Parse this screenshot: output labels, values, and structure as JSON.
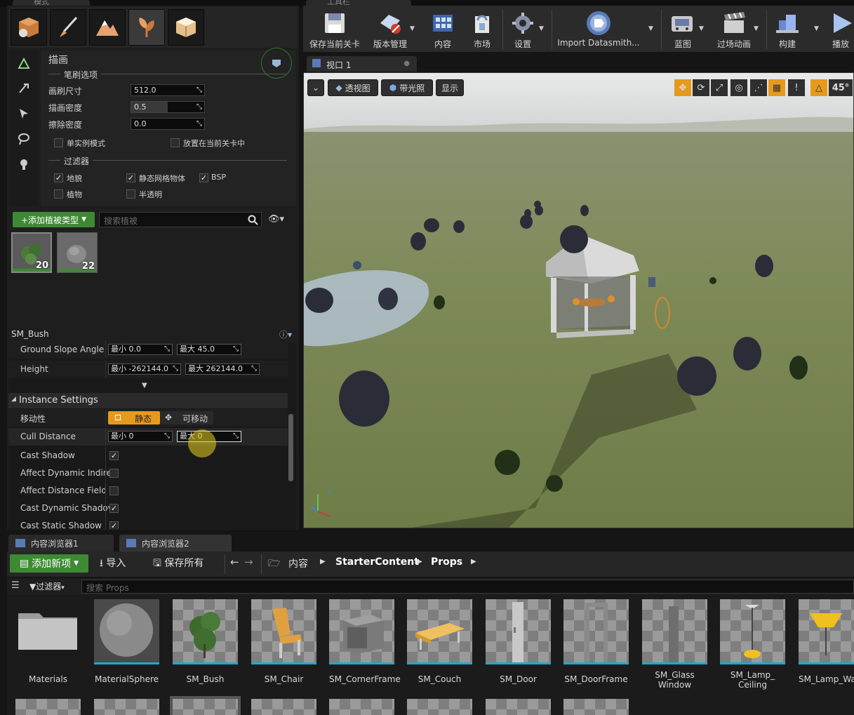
{
  "top_tabs": {
    "left": "模式",
    "right": "工具栏"
  },
  "mode_tools": [
    {
      "icon": "place-mode-icon"
    },
    {
      "icon": "paint-mode-icon"
    },
    {
      "icon": "landscape-mode-icon"
    },
    {
      "icon": "foliage-mode-icon"
    },
    {
      "icon": "geometry-mode-icon"
    }
  ],
  "foliage": {
    "panel_title": "描画",
    "brush_section": "笔刷选项",
    "brush_size_label": "画刷尺寸",
    "brush_size_value": "512.0",
    "paint_density_label": "描画密度",
    "paint_density_value": "0.5",
    "paint_density_fraction": 0.5,
    "erase_density_label": "擦除密度",
    "erase_density_value": "0.0",
    "single_instance_label": "单实例模式",
    "single_instance_checked": false,
    "place_in_level_label": "放置在当前关卡中",
    "place_in_level_checked": false,
    "filter_section": "过滤器",
    "filters": [
      {
        "label": "地貌",
        "checked": true
      },
      {
        "label": "静态网格物体",
        "checked": true
      },
      {
        "label": "BSP",
        "checked": true
      },
      {
        "label": "植物",
        "checked": false
      },
      {
        "label": "半透明",
        "checked": false
      }
    ],
    "add_button": "+添加植被类型",
    "search_placeholder": "搜索植被",
    "thumb_counts": [
      "20",
      "22"
    ],
    "selected_mesh": "SM_Bush"
  },
  "details": {
    "ground_slope_label": "Ground Slope Angle",
    "ground_slope_min": "最小  0.0",
    "ground_slope_max": "最大  45.0",
    "height_label": "Height",
    "height_min": "最小  -262144.0",
    "height_max": "最大  262144.0",
    "instance_section": "Instance Settings",
    "mobility_label": "移动性",
    "mobility_static": "静态",
    "mobility_movable": "可移动",
    "cull_label": "Cull Distance",
    "cull_min": "最小  0",
    "cull_max": "最大  0",
    "checks": [
      {
        "label": "Cast Shadow",
        "checked": true
      },
      {
        "label": "Affect Dynamic Indire",
        "checked": false
      },
      {
        "label": "Affect Distance Field",
        "checked": false
      },
      {
        "label": "Cast Dynamic Shadov",
        "checked": true
      },
      {
        "label": "Cast Static Shadow",
        "checked": true
      }
    ]
  },
  "toolbar": [
    {
      "label": "保存当前关卡",
      "icon": "save-icon"
    },
    {
      "label": "版本管理",
      "icon": "source-control-icon"
    },
    {
      "label": "内容",
      "icon": "content-icon"
    },
    {
      "label": "市场",
      "icon": "marketplace-icon"
    },
    {
      "label": "设置",
      "icon": "settings-icon"
    },
    {
      "label": "Import Datasmith...",
      "icon": "datasmith-icon"
    },
    {
      "label": "蓝图",
      "icon": "blueprint-icon"
    },
    {
      "label": "过场动画",
      "icon": "cinematics-icon"
    },
    {
      "label": "构建",
      "icon": "build-icon"
    },
    {
      "label": "播放",
      "icon": "play-icon"
    }
  ],
  "viewport": {
    "tab": "视口 1",
    "perspective": "透视图",
    "lit": "带光照",
    "show": "显示",
    "snap_angle": "45°"
  },
  "content_browser": {
    "tabs": [
      "内容浏览器1",
      "内容浏览器2"
    ],
    "add_new": "添加新项",
    "import": "导入",
    "save_all": "保存所有",
    "breadcrumb": [
      "内容",
      "StarterContent",
      "Props"
    ],
    "filters": "过滤器",
    "search_placeholder": "搜索 Props",
    "assets": [
      "Materials",
      "MaterialSphere",
      "SM_Bush",
      "SM_Chair",
      "SM_CornerFrame",
      "SM_Couch",
      "SM_Door",
      "SM_DoorFrame",
      "SM_Glass Window",
      "SM_Lamp_ Ceiling",
      "SM_Lamp_Wa"
    ]
  },
  "colors": {
    "accent_green": "#3d8a33",
    "accent_orange": "#e59a1c",
    "asset_underline": "#1fa6d6"
  }
}
